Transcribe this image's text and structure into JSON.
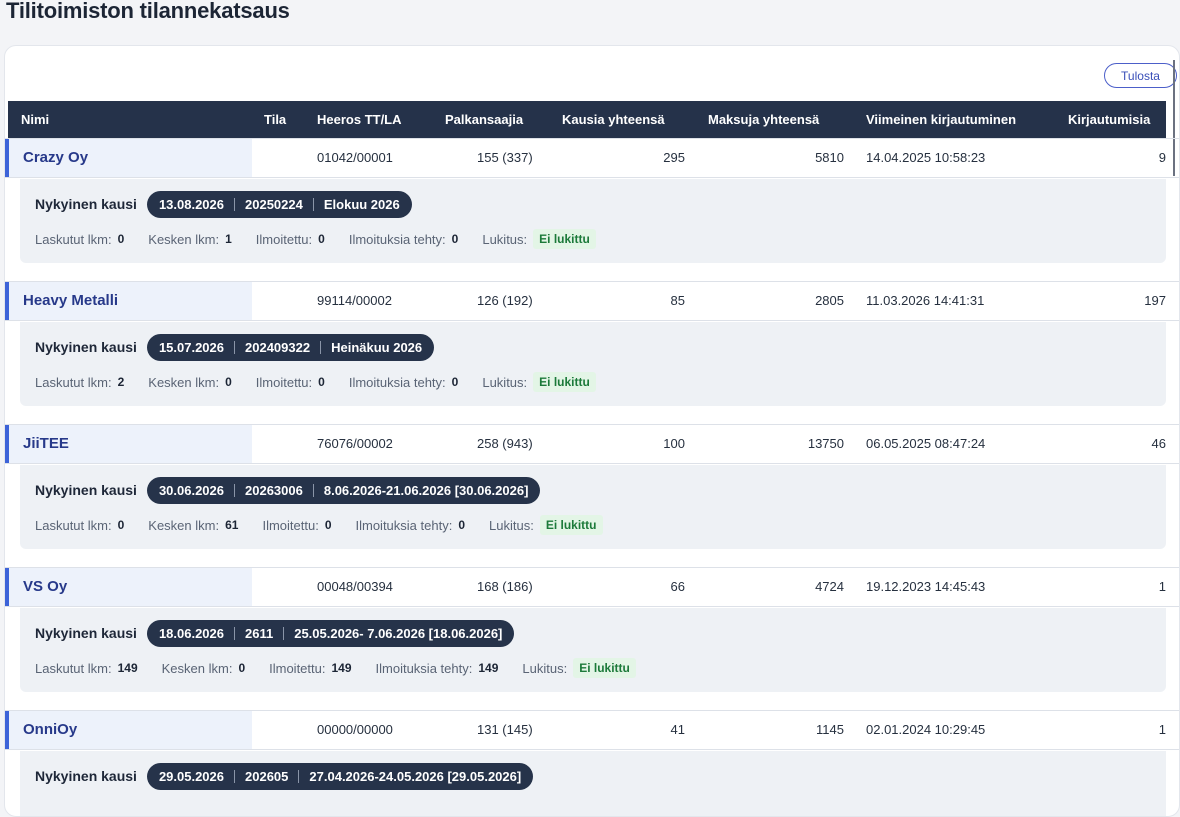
{
  "title": "Tilitoimiston tilannekatsaus",
  "print_label": "Tulosta",
  "columns": [
    "Nimi",
    "Tila",
    "Heeros TT/LA",
    "Palkansaajia",
    "Kausia yhteensä",
    "Maksuja yhteensä",
    "Viimeinen kirjautuminen",
    "Kirjautumisia"
  ],
  "labels": {
    "current_period": "Nykyinen kausi",
    "invoiced": "Laskutut lkm:",
    "in_progress": "Kesken lkm:",
    "reported": "Ilmoitettu:",
    "reports_made": "Ilmoituksia tehty:",
    "lock": "Lukitus:"
  },
  "colors": {
    "header_bg": "#25324a",
    "accent": "#3d63d8",
    "lock_green": "#1c7a3a"
  },
  "companies": [
    {
      "name": "Crazy Oy",
      "tila": "",
      "heeros": "01042/00001",
      "employees": "155 (337)",
      "periods": "295",
      "payments": "5810",
      "last_login": "14.04.2025 10:58:23",
      "logins": "9",
      "period": {
        "date": "13.08.2026",
        "code": "20250224",
        "label": "Elokuu 2026"
      },
      "stats": {
        "invoiced": "0",
        "in_progress": "1",
        "reported": "0",
        "reports_made": "0",
        "lock": "Ei lukittu"
      }
    },
    {
      "name": "Heavy Metalli",
      "tila": "",
      "heeros": "99114/00002",
      "employees": "126 (192)",
      "periods": "85",
      "payments": "2805",
      "last_login": "11.03.2026 14:41:31",
      "logins": "197",
      "period": {
        "date": "15.07.2026",
        "code": "202409322",
        "label": "Heinäkuu 2026"
      },
      "stats": {
        "invoiced": "2",
        "in_progress": "0",
        "reported": "0",
        "reports_made": "0",
        "lock": "Ei lukittu"
      }
    },
    {
      "name": "JiiTEE",
      "tila": "",
      "heeros": "76076/00002",
      "employees": "258 (943)",
      "periods": "100",
      "payments": "13750",
      "last_login": "06.05.2025 08:47:24",
      "logins": "46",
      "period": {
        "date": "30.06.2026",
        "code": "20263006",
        "label": "8.06.2026-21.06.2026 [30.06.2026]"
      },
      "stats": {
        "invoiced": "0",
        "in_progress": "61",
        "reported": "0",
        "reports_made": "0",
        "lock": "Ei lukittu"
      }
    },
    {
      "name": "VS Oy",
      "tila": "",
      "heeros": "00048/00394",
      "employees": "168 (186)",
      "periods": "66",
      "payments": "4724",
      "last_login": "19.12.2023 14:45:43",
      "logins": "1",
      "period": {
        "date": "18.06.2026",
        "code": "2611",
        "label": "25.05.2026- 7.06.2026 [18.06.2026]"
      },
      "stats": {
        "invoiced": "149",
        "in_progress": "0",
        "reported": "149",
        "reports_made": "149",
        "lock": "Ei lukittu"
      }
    },
    {
      "name": "OnniOy",
      "tila": "",
      "heeros": "00000/00000",
      "employees": "131 (145)",
      "periods": "41",
      "payments": "1145",
      "last_login": "02.01.2024 10:29:45",
      "logins": "1",
      "period": {
        "date": "29.05.2026",
        "code": "202605",
        "label": "27.04.2026-24.05.2026 [29.05.2026]"
      },
      "stats": {
        "invoiced": "",
        "in_progress": "",
        "reported": "",
        "reports_made": "",
        "lock": ""
      }
    }
  ]
}
